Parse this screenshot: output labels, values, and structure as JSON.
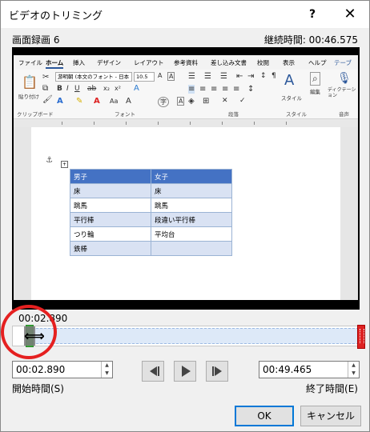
{
  "dialog": {
    "title": "ビデオのトリミング",
    "help": "?",
    "close": "✕"
  },
  "video": {
    "name": "画面録画 6",
    "duration_label": "継続時間: 00:46.575"
  },
  "ribbon": {
    "tabs": [
      "ファイル",
      "ホーム",
      "挿入",
      "デザイン",
      "レイアウト",
      "参考資料",
      "差し込み文書",
      "校閲",
      "表示",
      "ヘルプ",
      "テーブ"
    ],
    "font_name": "游明朝 (本文のフォント - 日本",
    "font_size": "10.5",
    "groups": [
      "クリップボード",
      "フォント",
      "段落",
      "スタイル",
      "音声"
    ],
    "paste": "貼り付け",
    "style": "スタイル",
    "edit": "編集",
    "dictation": "ディクテーション"
  },
  "doc_table": {
    "rows": [
      [
        "男子",
        "女子"
      ],
      [
        "床",
        "床"
      ],
      [
        "跳馬",
        "跳馬"
      ],
      [
        "平行棒",
        "段違い平行棒"
      ],
      [
        "つり輪",
        "平均台"
      ],
      [
        "鉄棒",
        ""
      ]
    ]
  },
  "timeline": {
    "current_time": "00:02.890",
    "start_fraction": 0.062,
    "end_fraction": 1.0
  },
  "start": {
    "value": "00:02.890",
    "label": "開始時間(S)"
  },
  "end": {
    "value": "00:49.465",
    "label": "終了時間(E)"
  },
  "buttons": {
    "ok": "OK",
    "cancel": "キャンセル"
  },
  "colors": {
    "start_handle": "#3dab3d",
    "end_handle": "#dd2222",
    "highlight_circle": "#e52020",
    "table_header": "#4472c4"
  }
}
